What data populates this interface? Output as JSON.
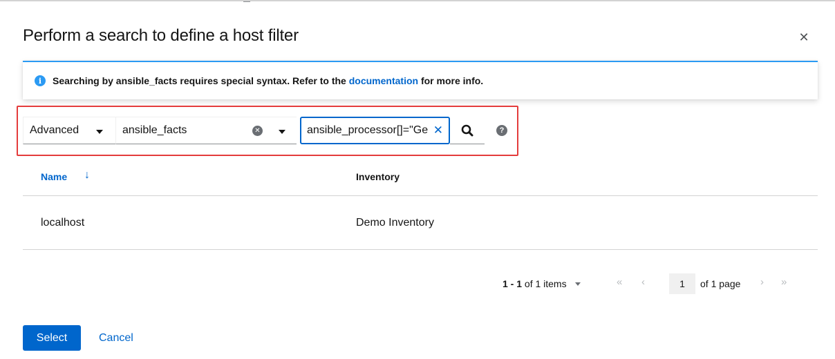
{
  "modal": {
    "title": "Perform a search to define a host filter",
    "close_glyph": "✕"
  },
  "alert": {
    "icon": "info-icon",
    "text_before": "Searching by ansible_facts requires special syntax. Refer to the",
    "link_text": "documentation",
    "text_after": "for more info.",
    "accent_color": "#2b9af3"
  },
  "search": {
    "type_value": "Advanced",
    "key_value": "ansible_facts",
    "input_value": "ansible_processor[]=\"Ge",
    "search_icon": "search-icon",
    "help_icon": "help-icon",
    "highlight_color": "#e43b3b"
  },
  "table": {
    "columns": [
      {
        "label": "Name",
        "sort": "ascending",
        "sort_icon": "sort-arrow-down-icon"
      },
      {
        "label": "Inventory"
      }
    ],
    "rows": [
      {
        "name": "localhost",
        "inventory": "Demo Inventory"
      }
    ]
  },
  "pagination": {
    "range": "1 - 1",
    "of_items": "of 1 items",
    "page": "1",
    "of_pages": "of 1 page"
  },
  "footer": {
    "select_label": "Select",
    "cancel_label": "Cancel",
    "primary_color": "#0066cc"
  }
}
